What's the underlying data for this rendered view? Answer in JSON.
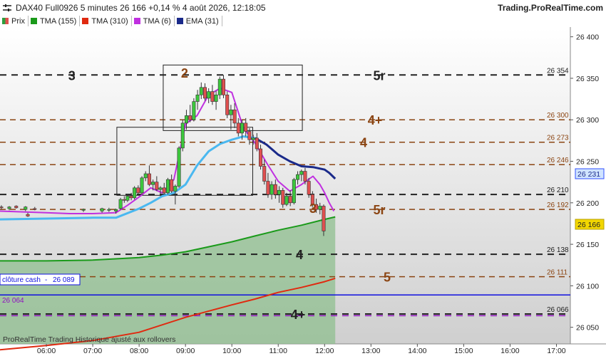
{
  "header": {
    "title": "DAX40 Full0926 5 minutes 26 166 +0,14 % 4 août 2026, 12:18:05",
    "site": "Trading.ProRealTime.com"
  },
  "legend": [
    {
      "label": "Prix",
      "color": "#2e9e3e"
    },
    {
      "label": "TMA (155)",
      "color": "#1a9a1a"
    },
    {
      "label": "TMA (310)",
      "color": "#e02a10"
    },
    {
      "label": "TMA (6)",
      "color": "#c030e0"
    },
    {
      "label": "EMA (31)",
      "color": "#1a2a8a"
    }
  ],
  "footer": "ProRealTime Trading  Historique ajusté aux rollovers",
  "chart_data": {
    "type": "line",
    "title": "DAX40 Full0926 5 minutes",
    "ylim": [
      26030,
      26410
    ],
    "yticks": [
      26050,
      26100,
      26150,
      26200,
      26250,
      26300,
      26350,
      26400
    ],
    "ytick_labels": [
      "26 050",
      "26 100",
      "26 150",
      "26 200",
      "26 250",
      "26 300",
      "26 350",
      "26 400"
    ],
    "x_tick_labels": [
      "06:00",
      "07:00",
      "08:00",
      "09:00",
      "10:00",
      "11:00",
      "12:00",
      "13:00",
      "14:00",
      "15:00",
      "16:00",
      "17:00"
    ],
    "x_tick_hours": [
      6,
      7,
      8,
      9,
      10,
      11,
      12,
      13,
      14,
      15,
      16,
      17
    ],
    "x_range_hours": [
      5.0,
      17.3
    ],
    "last_price": {
      "value": 26166,
      "label": "26 166",
      "color": "#f2d600"
    },
    "ema_last": {
      "value": 26231,
      "label": "26 231",
      "color": "#3050ff"
    },
    "cloture_cash": {
      "label": "clôture cash",
      "value_label": "26 089",
      "value": 26089,
      "color": "#1010e0"
    },
    "purple_level": {
      "label": "26 064",
      "value": 26064,
      "color": "#9010c0"
    },
    "levels": [
      {
        "value": 26354,
        "label": "26 354",
        "marker": "5r",
        "color": "#222222"
      },
      {
        "value": 26300,
        "label": "26 300",
        "marker": "4+",
        "color": "#8b4513"
      },
      {
        "value": 26273,
        "label": "26 273",
        "marker": "4",
        "color": "#8b4513"
      },
      {
        "value": 26246,
        "label": "26 246",
        "marker": "",
        "color": "#8b4513"
      },
      {
        "value": 26210,
        "label": "26 210",
        "marker": "",
        "color": "#222222"
      },
      {
        "value": 26192,
        "label": "26 192",
        "marker": "5r",
        "color": "#8b4513"
      },
      {
        "value": 26138,
        "label": "26 138",
        "marker": "4",
        "color": "#222222"
      },
      {
        "value": 26111,
        "label": "26 111",
        "marker": "5",
        "color": "#8b4513"
      },
      {
        "value": 26066,
        "label": "26 066",
        "marker": "4+",
        "color": "#222222"
      }
    ],
    "zone_labels": [
      {
        "text": "3",
        "hour": 6.55,
        "value": 26354,
        "color": "#222222"
      },
      {
        "text": "2",
        "hour": 8.98,
        "value": 26357,
        "color": "#8b4513"
      },
      {
        "text": "3",
        "hour": 11.75,
        "value": 26194,
        "color": "#8b4513"
      }
    ],
    "boxes": [
      {
        "x0": 8.52,
        "x1": 11.52,
        "y0": 26287,
        "y1": 26366
      },
      {
        "x0": 7.52,
        "x1": 10.45,
        "y0": 26209,
        "y1": 26291
      }
    ],
    "series": [
      {
        "name": "TMA (155)",
        "color": "#1a9a1a",
        "x": [
          5.0,
          6.0,
          7.0,
          8.0,
          8.5,
          9.0,
          9.5,
          10.0,
          10.5,
          11.0,
          11.5,
          12.0,
          12.23
        ],
        "y": [
          26130,
          26130,
          26131,
          26134,
          26137,
          26141,
          26147,
          26153,
          26160,
          26167,
          26173,
          26180,
          26183
        ]
      },
      {
        "name": "TMA (310)",
        "color": "#e02a10",
        "x": [
          5.0,
          6.0,
          7.0,
          8.0,
          9.0,
          10.0,
          10.5,
          11.0,
          11.5,
          12.0,
          12.23
        ],
        "y": [
          26023,
          26028,
          26034,
          26044,
          26062,
          26077,
          26084,
          26092,
          26098,
          26105,
          26109
        ]
      },
      {
        "name": "TMA (6)",
        "color": "#c030e0",
        "x": [
          5.0,
          5.5,
          6.0,
          6.5,
          7.0,
          7.5,
          7.75,
          8.0,
          8.25,
          8.5,
          8.75,
          9.0,
          9.25,
          9.5,
          9.75,
          10.0,
          10.25,
          10.5,
          10.75,
          11.0,
          11.25,
          11.5,
          11.75,
          11.9,
          12.0,
          12.1,
          12.2
        ],
        "y": [
          26190,
          26189,
          26188,
          26187,
          26187,
          26188,
          26197,
          26207,
          26218,
          26212,
          26228,
          26295,
          26305,
          26330,
          26338,
          26333,
          26290,
          26272,
          26248,
          26226,
          26214,
          26222,
          26232,
          26222,
          26212,
          26200,
          26190
        ]
      },
      {
        "name": "EMA (31)",
        "color": "#1a2a8a",
        "x": [
          10.5,
          10.75,
          11.0,
          11.25,
          11.5,
          11.75,
          12.0,
          12.1,
          12.23
        ],
        "y": [
          26278,
          26270,
          26258,
          26250,
          26244,
          26243,
          26240,
          26236,
          26229
        ]
      },
      {
        "name": "EMA (31)",
        "color": "#4ab8f0",
        "x": [
          5.0,
          6.0,
          7.0,
          7.5,
          8.0,
          8.25,
          8.5,
          8.75,
          9.0,
          9.25,
          9.5,
          9.75,
          10.0,
          10.25,
          10.5
        ],
        "y": [
          26180,
          26181,
          26182,
          26182,
          26193,
          26200,
          26208,
          26212,
          26222,
          26245,
          26262,
          26271,
          26276,
          26280,
          26278
        ]
      }
    ],
    "candles": [
      [
        5.03,
        26195,
        26197,
        26192,
        26194
      ],
      [
        5.2,
        26193,
        26196,
        26191,
        26195
      ],
      [
        5.35,
        26196,
        26197,
        26193,
        26194
      ],
      [
        5.55,
        26192,
        26196,
        26190,
        26195
      ],
      [
        5.6,
        26186,
        26188,
        26183,
        26184
      ],
      [
        5.75,
        26193,
        26195,
        26191,
        26192
      ],
      [
        6.8,
        26191,
        26193,
        26189,
        26192
      ],
      [
        7.2,
        26190,
        26194,
        26188,
        26193
      ],
      [
        7.35,
        26191,
        26194,
        26189,
        26192
      ],
      [
        7.5,
        26190,
        26193,
        26187,
        26192
      ],
      [
        7.6,
        26193,
        26206,
        26192,
        26204
      ],
      [
        7.68,
        26204,
        26208,
        26200,
        26203
      ],
      [
        7.75,
        26203,
        26210,
        26201,
        26208
      ],
      [
        7.83,
        26208,
        26212,
        26203,
        26206
      ],
      [
        7.9,
        26206,
        26220,
        26204,
        26218
      ],
      [
        7.98,
        26218,
        26221,
        26210,
        26212
      ],
      [
        8.06,
        26212,
        26232,
        26210,
        26230
      ],
      [
        8.14,
        26230,
        26238,
        26226,
        26235
      ],
      [
        8.22,
        26235,
        26245,
        26220,
        26222
      ],
      [
        8.3,
        26222,
        26228,
        26215,
        26225
      ],
      [
        8.38,
        26225,
        26232,
        26214,
        26216
      ],
      [
        8.46,
        26216,
        26220,
        26208,
        26218
      ],
      [
        8.54,
        26218,
        26224,
        26210,
        26212
      ],
      [
        8.62,
        26212,
        26230,
        26210,
        26228
      ],
      [
        8.7,
        26228,
        26234,
        26212,
        26214
      ],
      [
        8.78,
        26214,
        26222,
        26198,
        26220
      ],
      [
        8.86,
        26220,
        26268,
        26218,
        26266
      ],
      [
        8.94,
        26266,
        26300,
        26262,
        26296
      ],
      [
        9.02,
        26296,
        26312,
        26288,
        26305
      ],
      [
        9.1,
        26305,
        26318,
        26297,
        26300
      ],
      [
        9.18,
        26300,
        26326,
        26298,
        26322
      ],
      [
        9.26,
        26322,
        26336,
        26312,
        26330
      ],
      [
        9.34,
        26330,
        26345,
        26325,
        26339
      ],
      [
        9.42,
        26339,
        26344,
        26323,
        26326
      ],
      [
        9.5,
        26326,
        26338,
        26320,
        26334
      ],
      [
        9.58,
        26334,
        26342,
        26318,
        26322
      ],
      [
        9.66,
        26322,
        26335,
        26312,
        26330
      ],
      [
        9.74,
        26330,
        26352,
        26325,
        26349
      ],
      [
        9.82,
        26349,
        26354,
        26326,
        26330
      ],
      [
        9.9,
        26330,
        26334,
        26302,
        26306
      ],
      [
        9.98,
        26306,
        26318,
        26288,
        26312
      ],
      [
        10.06,
        26312,
        26320,
        26290,
        26296
      ],
      [
        10.14,
        26296,
        26302,
        26280,
        26284
      ],
      [
        10.22,
        26284,
        26300,
        26276,
        26296
      ],
      [
        10.3,
        26296,
        26302,
        26280,
        26286
      ],
      [
        10.38,
        26286,
        26290,
        26270,
        26276
      ],
      [
        10.46,
        26276,
        26282,
        26270,
        26278
      ],
      [
        10.54,
        26278,
        26284,
        26262,
        26265
      ],
      [
        10.62,
        26265,
        26270,
        26240,
        26244
      ],
      [
        10.7,
        26244,
        26252,
        26222,
        26226
      ],
      [
        10.78,
        26226,
        26236,
        26206,
        26210
      ],
      [
        10.86,
        26210,
        26226,
        26204,
        26222
      ],
      [
        10.94,
        26222,
        26228,
        26205,
        26210
      ],
      [
        11.02,
        26210,
        26220,
        26200,
        26215
      ],
      [
        11.1,
        26215,
        26218,
        26194,
        26198
      ],
      [
        11.18,
        26198,
        26212,
        26196,
        26208
      ],
      [
        11.26,
        26208,
        26215,
        26196,
        26200
      ],
      [
        11.34,
        26200,
        26230,
        26198,
        26228
      ],
      [
        11.42,
        26228,
        26238,
        26222,
        26234
      ],
      [
        11.5,
        26234,
        26240,
        26226,
        26238
      ],
      [
        11.58,
        26238,
        26242,
        26222,
        26226
      ],
      [
        11.66,
        26226,
        26230,
        26206,
        26210
      ],
      [
        11.74,
        26210,
        26214,
        26195,
        26198
      ],
      [
        11.82,
        26198,
        26205,
        26188,
        26192
      ],
      [
        11.9,
        26192,
        26200,
        26186,
        26196
      ],
      [
        11.98,
        26196,
        26198,
        26160,
        26166
      ]
    ]
  }
}
